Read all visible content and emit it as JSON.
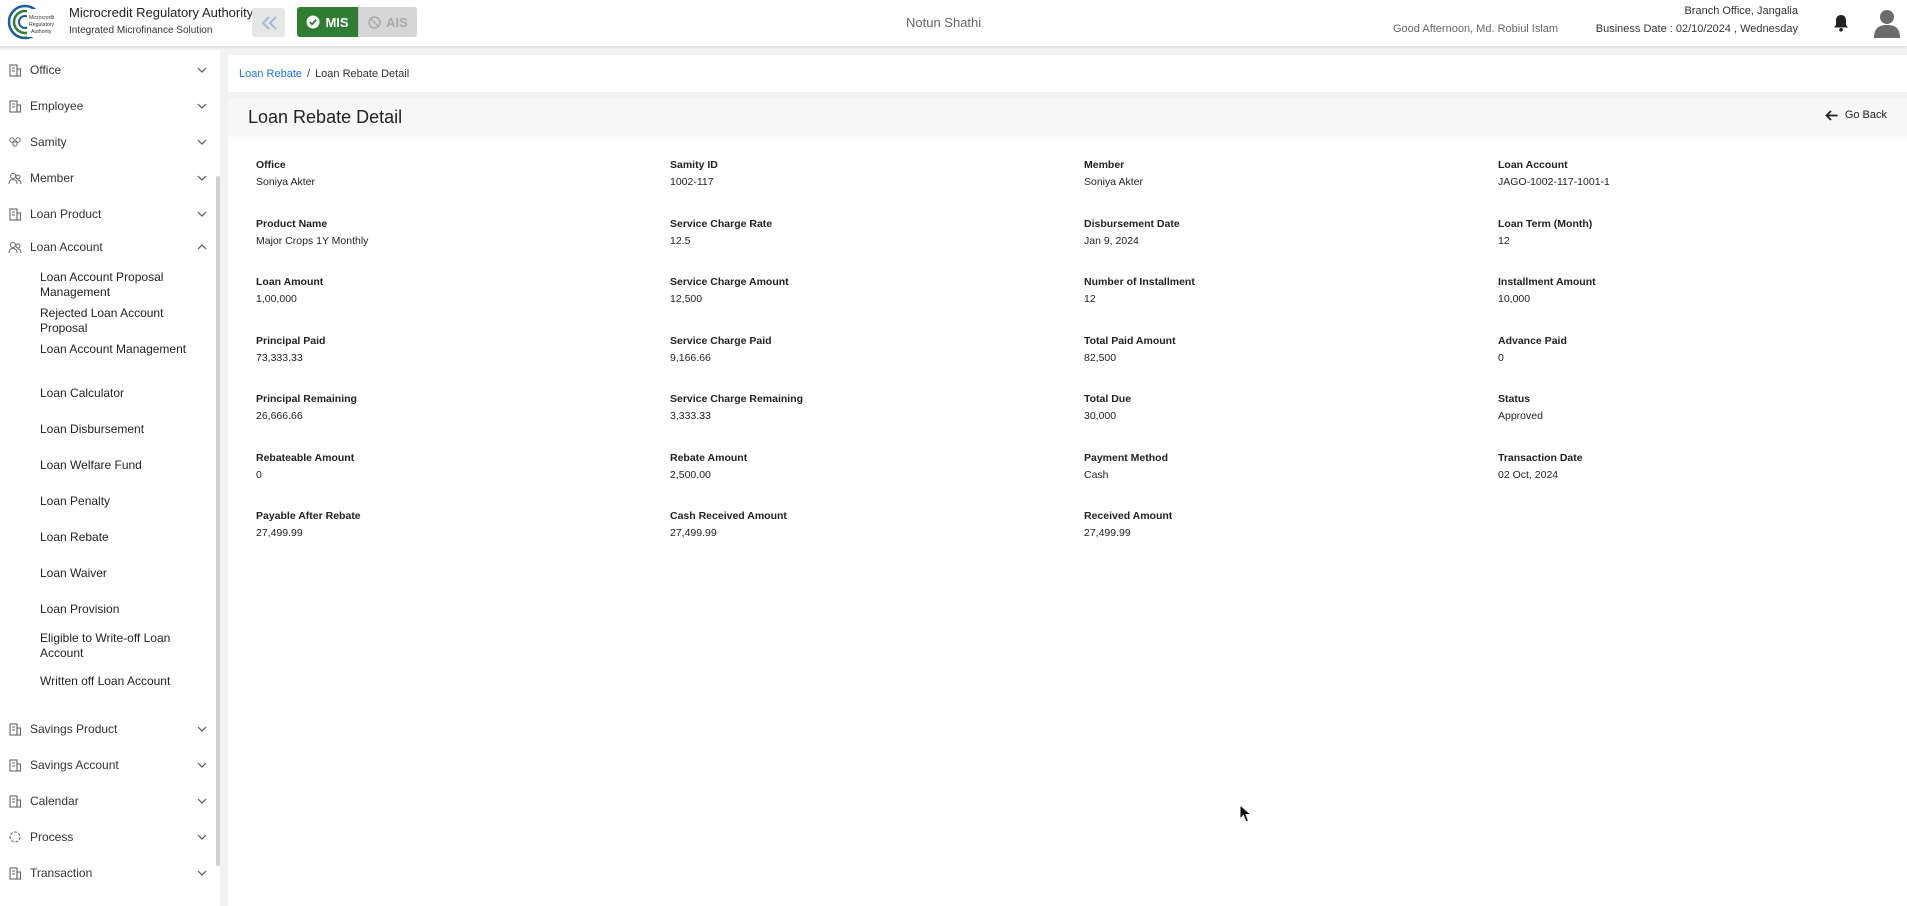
{
  "header": {
    "org_name": "Microcredit Regulatory Authority",
    "org_subtitle": "Integrated Microfinance Solution",
    "logo_text": "Microcredit Regulatory Authority",
    "modules": {
      "mis": "MIS",
      "ais": "AIS"
    },
    "app_title": "Notun Shathi",
    "greeting": "Good Afternoon, Md. Robiul Islam",
    "branch": "Branch Office, Jangalia",
    "business_date": "Business Date : 02/10/2024 , Wednesday",
    "colors": {
      "mis_active": "#2e7d32",
      "ais_inactive": "#d6d6d6",
      "link": "#1a73e8"
    }
  },
  "sidebar": {
    "items": [
      {
        "label": "Office",
        "icon": "building-icon",
        "expanded": false
      },
      {
        "label": "Employee",
        "icon": "building-icon",
        "expanded": false
      },
      {
        "label": "Samity",
        "icon": "group-icon",
        "expanded": false
      },
      {
        "label": "Member",
        "icon": "users-icon",
        "expanded": false
      },
      {
        "label": "Loan Product",
        "icon": "building-icon",
        "expanded": false
      },
      {
        "label": "Loan Account",
        "icon": "users-icon",
        "expanded": true
      },
      {
        "label": "Savings Product",
        "icon": "building-icon",
        "expanded": false
      },
      {
        "label": "Savings Account",
        "icon": "building-icon",
        "expanded": false
      },
      {
        "label": "Calendar",
        "icon": "building-icon",
        "expanded": false
      },
      {
        "label": "Process",
        "icon": "process-icon",
        "expanded": false
      },
      {
        "label": "Transaction",
        "icon": "building-icon",
        "expanded": false
      }
    ],
    "loan_account_children": [
      "Loan Account Proposal Management",
      "Rejected Loan Account Proposal",
      "Loan Account Management",
      "Loan Calculator",
      "Loan Disbursement",
      "Loan Welfare Fund",
      "Loan Penalty",
      "Loan Rebate",
      "Loan Waiver",
      "Loan Provision",
      "Eligible to Write-off Loan Account",
      "Written off Loan Account"
    ]
  },
  "breadcrumb": {
    "parent": "Loan Rebate",
    "separator": "/",
    "current": "Loan Rebate Detail"
  },
  "detail": {
    "title": "Loan Rebate Detail",
    "go_back": "Go Back",
    "fields": [
      {
        "label": "Office",
        "value": "Soniya Akter"
      },
      {
        "label": "Samity ID",
        "value": "1002-117"
      },
      {
        "label": "Member",
        "value": "Soniya Akter"
      },
      {
        "label": "Loan Account",
        "value": "JAGO-1002-117-1001-1"
      },
      {
        "label": "Product Name",
        "value": "Major Crops 1Y Monthly"
      },
      {
        "label": "Service Charge Rate",
        "value": "12.5"
      },
      {
        "label": "Disbursement Date",
        "value": "Jan 9, 2024"
      },
      {
        "label": "Loan Term (Month)",
        "value": "12"
      },
      {
        "label": "Loan Amount",
        "value": "1,00,000"
      },
      {
        "label": "Service Charge Amount",
        "value": "12,500"
      },
      {
        "label": "Number of Installment",
        "value": "12"
      },
      {
        "label": "Installment Amount",
        "value": "10,000"
      },
      {
        "label": "Principal Paid",
        "value": "73,333.33"
      },
      {
        "label": "Service Charge Paid",
        "value": "9,166.66"
      },
      {
        "label": "Total Paid Amount",
        "value": "82,500"
      },
      {
        "label": "Advance Paid",
        "value": "0"
      },
      {
        "label": "Principal Remaining",
        "value": "26,666.66"
      },
      {
        "label": "Service Charge Remaining",
        "value": "3,333.33"
      },
      {
        "label": "Total Due",
        "value": "30,000"
      },
      {
        "label": "Status",
        "value": "Approved"
      },
      {
        "label": "Rebateable Amount",
        "value": "0"
      },
      {
        "label": "Rebate Amount",
        "value": "2,500.00"
      },
      {
        "label": "Payment Method",
        "value": "Cash"
      },
      {
        "label": "Transaction Date",
        "value": "02 Oct, 2024"
      },
      {
        "label": "Payable After Rebate",
        "value": "27,499.99"
      },
      {
        "label": "Cash Received Amount",
        "value": "27,499.99"
      },
      {
        "label": "Received Amount",
        "value": "27,499.99"
      }
    ]
  }
}
